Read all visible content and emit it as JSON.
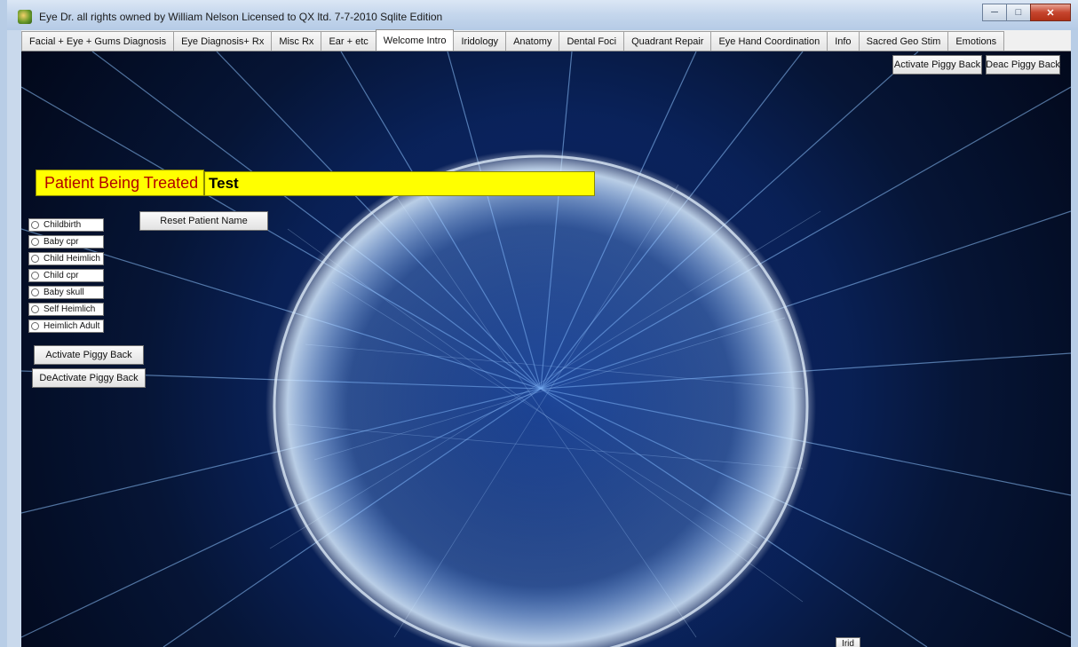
{
  "window": {
    "title": "Eye Dr.   all rights owned by William Nelson Licensed to QX ltd.   7-7-2010 Sqlite Edition",
    "app_icon": "app-logo-icon",
    "controls": [
      "minimize-icon",
      "maximize-icon",
      "close-icon"
    ]
  },
  "tabs": [
    {
      "label": "Facial + Eye + Gums Diagnosis",
      "active": false
    },
    {
      "label": "Eye Diagnosis+ Rx",
      "active": false
    },
    {
      "label": "Misc Rx",
      "active": false
    },
    {
      "label": "Ear + etc",
      "active": false
    },
    {
      "label": "Welcome Intro",
      "active": true
    },
    {
      "label": "Iridology",
      "active": false
    },
    {
      "label": "Anatomy",
      "active": false
    },
    {
      "label": "Dental Foci",
      "active": false
    },
    {
      "label": "Quadrant Repair",
      "active": false
    },
    {
      "label": "Eye Hand Coordination",
      "active": false
    },
    {
      "label": "Info",
      "active": false
    },
    {
      "label": "Sacred Geo Stim",
      "active": false
    },
    {
      "label": "Emotions",
      "active": false
    }
  ],
  "top_buttons": {
    "activate": "Activate Piggy Back",
    "deactivate": "Deac Piggy Back"
  },
  "patient": {
    "label": "Patient Being Treated",
    "name": "Test"
  },
  "reset_button": "Reset Patient Name",
  "options": [
    {
      "label": "Childbirth",
      "checked": false
    },
    {
      "label": "Baby cpr",
      "checked": false
    },
    {
      "label": "Child Heimlich",
      "checked": false
    },
    {
      "label": "Child cpr",
      "checked": false
    },
    {
      "label": "Baby skull",
      "checked": false
    },
    {
      "label": "Self Heimlich",
      "checked": false
    },
    {
      "label": "Heimlich Adult",
      "checked": false
    }
  ],
  "left_buttons": {
    "activate": "Activate Piggy Back",
    "deactivate": "DeActivate Piggy Back"
  },
  "bottom_button": "Irid"
}
